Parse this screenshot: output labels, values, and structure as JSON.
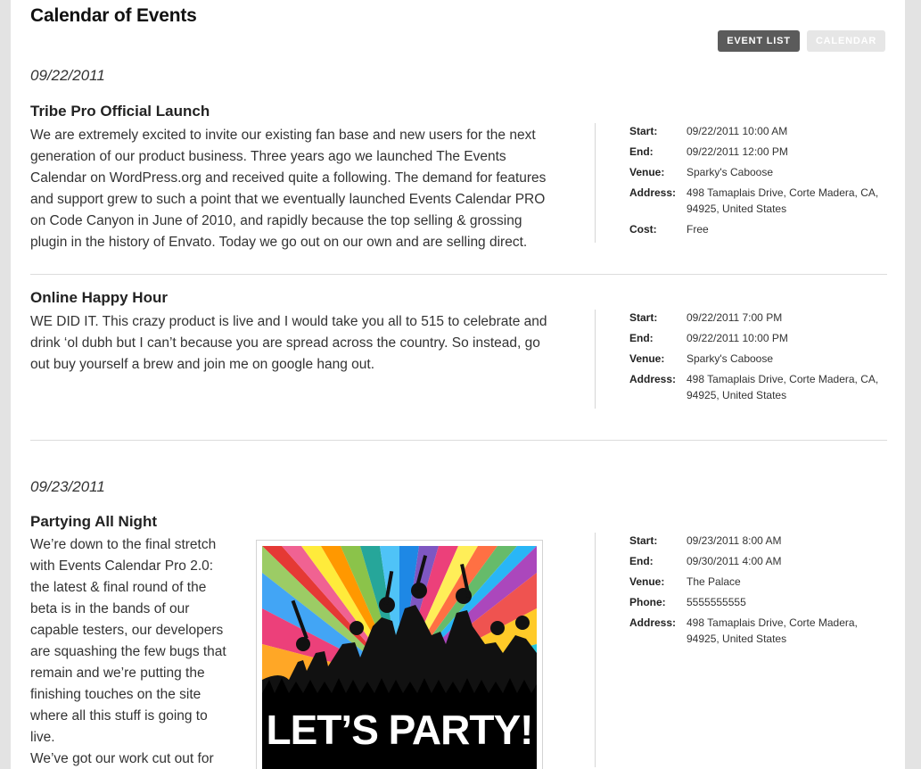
{
  "header": {
    "title": "Calendar of Events",
    "view_buttons": {
      "event_list": "EVENT LIST",
      "calendar": "CALENDAR"
    }
  },
  "groups": [
    {
      "date": "09/22/2011",
      "events": [
        {
          "title": "Tribe Pro Official Launch",
          "description_lines": [
            "We are extremely excited to invite our existing fan base and new users for the next",
            "generation of our product business. Three years ago we launched The Events",
            "Calendar on WordPress.org and received quite a following. The demand for features",
            "and support grew to such a point that we eventually launched Events Calendar PRO",
            "on Code Canyon in June of 2010, and rapidly because the top selling & grossing",
            "plugin in the history of Envato. Today we go out on our own and are selling direct."
          ],
          "meta": {
            "start_label": "Start:",
            "start": "09/22/2011 10:00 AM",
            "end_label": "End:",
            "end": "09/22/2011 12:00 PM",
            "venue_label": "Venue:",
            "venue": "Sparky's Caboose",
            "address_label": "Address:",
            "address_line1": "498 Tamaplais Drive, Corte Madera, CA,",
            "address_line2": "94925, United States",
            "cost_label": "Cost:",
            "cost": "Free"
          }
        },
        {
          "title": "Online Happy Hour",
          "description_lines": [
            "WE DID IT. This crazy product is live and I would take you all to 515 to celebrate and",
            "drink ‘ol dubh but I can’t because you are spread across the country. So instead, go",
            "out buy yourself a brew and join me on google hang out."
          ],
          "meta": {
            "start_label": "Start:",
            "start": "09/22/2011 7:00 PM",
            "end_label": "End:",
            "end": "09/22/2011 10:00 PM",
            "venue_label": "Venue:",
            "venue": "Sparky's Caboose",
            "address_label": "Address:",
            "address_line1": "498 Tamaplais Drive, Corte Madera, CA,",
            "address_line2": "94925, United States"
          }
        }
      ]
    },
    {
      "date": "09/23/2011",
      "events": [
        {
          "title": "Partying All Night",
          "description_lines": [
            "We’re down to the final stretch",
            "with Events Calendar Pro 2.0:",
            "the latest & final round of the",
            "beta is in the bands of our",
            "capable testers, our developers",
            "are squashing the few bugs that",
            "remain and we’re putting the",
            "finishing touches on the site",
            "where all this stuff is going to",
            "live.",
            "We’ve got our work cut out for"
          ],
          "image_text": "LET’S PARTY!",
          "meta": {
            "start_label": "Start:",
            "start": "09/23/2011 8:00 AM",
            "end_label": "End:",
            "end": "09/30/2011 4:00 AM",
            "venue_label": "Venue:",
            "venue": "The Palace",
            "phone_label": "Phone:",
            "phone": "5555555555",
            "address_label": "Address:",
            "address_line1": "498 Tamaplais Drive, Corte Madera,",
            "address_line2": "94925, United States"
          }
        }
      ]
    }
  ],
  "colors": {
    "active_button": "#5b5b5b",
    "inactive_button": "#e6e6e6",
    "page_background": "#e3e3e3"
  }
}
